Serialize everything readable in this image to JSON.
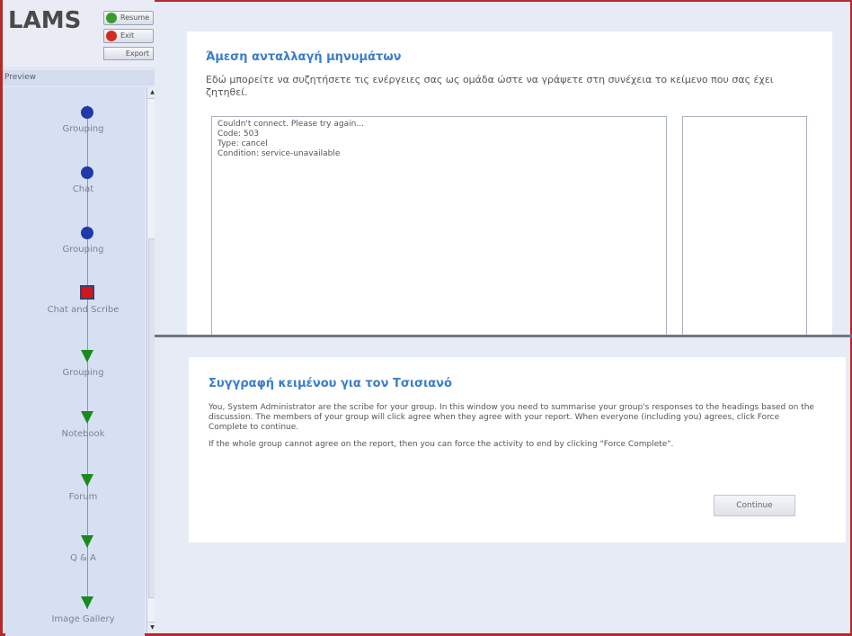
{
  "sidebar": {
    "logo": "LAMS",
    "resume_label": "Resume",
    "exit_label": "Exit",
    "export_label": "Export",
    "preview_label": "Preview",
    "activities": [
      {
        "label": "Grouping",
        "icon": "circle",
        "color": "#1f3aa8"
      },
      {
        "label": "Chat",
        "icon": "circle",
        "color": "#1f3aa8"
      },
      {
        "label": "Grouping",
        "icon": "circle",
        "color": "#1f3aa8"
      },
      {
        "label": "Chat and Scribe",
        "icon": "square",
        "color": "#d4141c"
      },
      {
        "label": "Grouping",
        "icon": "triangle",
        "color": "#1a8a1e"
      },
      {
        "label": "Notebook",
        "icon": "triangle",
        "color": "#1a8a1e"
      },
      {
        "label": "Forum",
        "icon": "triangle",
        "color": "#1a8a1e"
      },
      {
        "label": "Q & A",
        "icon": "triangle",
        "color": "#1a8a1e"
      },
      {
        "label": "Image Gallery",
        "icon": "triangle",
        "color": "#1a8a1e"
      }
    ]
  },
  "chat": {
    "title": "Άμεση ανταλλαγή μηνυμάτων",
    "description": "Εδώ μπορείτε να συζητήσετε τις ενέργειες σας ως ομάδα ώστε να γράψετε στη συνέχεια το κείμενο που σας έχει ζητηθεί.",
    "messages": [
      "Couldn't connect. Please try again...",
      "Code: 503",
      "Type: cancel",
      "Condition: service-unavailable"
    ]
  },
  "scribe": {
    "title": "Συγγραφή κειμένου για τον Τσισιανό",
    "paragraph1": "You, System Administrator are the scribe for your group. In this window you need to summarise your group's responses to the headings based on the discussion. The members of your group will click agree when they agree with your report. When everyone (including you) agrees, click Force Complete to continue.",
    "paragraph2": "If the whole group cannot agree on the report, then you can force the activity to end by clicking \"Force Complete\".",
    "continue_label": "Continue"
  },
  "colors": {
    "accent_title": "#3a7dcc",
    "frame_border": "#b52a2a",
    "resume_icon": "#3c9a2e",
    "exit_icon": "#d22b1f"
  }
}
